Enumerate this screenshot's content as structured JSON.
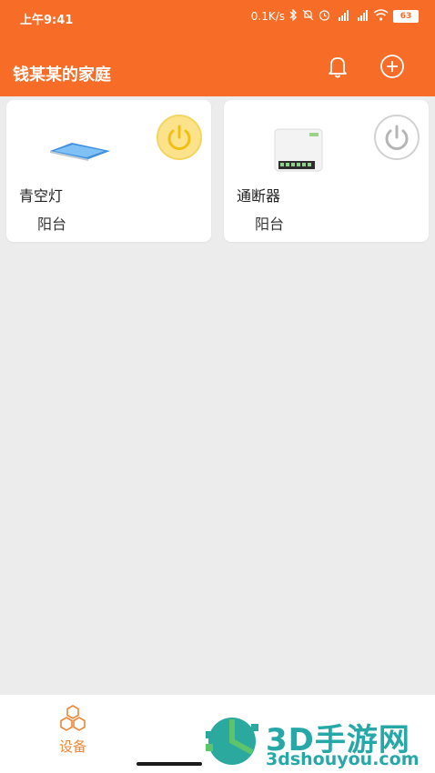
{
  "status_bar": {
    "time": "上午9:41",
    "network_speed": "0.1K/s",
    "battery": "63",
    "icons": [
      "bluetooth-icon",
      "mute-icon",
      "alarm-icon",
      "signal-hd-icon",
      "signal-hd-icon",
      "wifi-icon",
      "battery-icon"
    ]
  },
  "header": {
    "title": "钱某某的家庭",
    "icons": [
      "bell-icon",
      "add-circle-icon"
    ],
    "color": "#f76d28"
  },
  "devices": [
    {
      "name": "青空灯",
      "room": "阳台",
      "power_on": true,
      "icon": "light-panel-image",
      "power_color": "#f4c21a"
    },
    {
      "name": "通断器",
      "room": "阳台",
      "power_on": false,
      "icon": "switch-module-image",
      "power_color": "#b5b5b5"
    }
  ],
  "tabbar": {
    "items": [
      {
        "label": "设备",
        "icon": "hexagon-devices-icon",
        "active": true
      }
    ],
    "active_color": "#f08636"
  },
  "watermark": {
    "brand": "3D手游网",
    "url": "3dshouyou.com"
  }
}
